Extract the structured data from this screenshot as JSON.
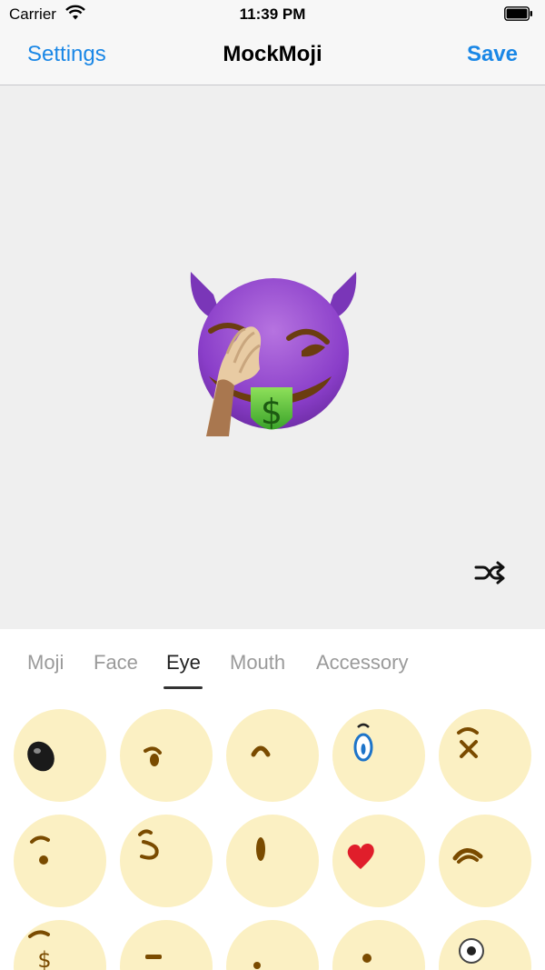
{
  "status_bar": {
    "carrier": "Carrier",
    "time": "11:39 PM"
  },
  "nav": {
    "left": "Settings",
    "title": "MockMoji",
    "right": "Save"
  },
  "preview": {
    "emoji_icon": "devil-facepalm-money-emoji-icon",
    "shuffle_icon": "shuffle-icon"
  },
  "tabs": [
    {
      "label": "Moji",
      "selected": false
    },
    {
      "label": "Face",
      "selected": false
    },
    {
      "label": "Eye",
      "selected": true
    },
    {
      "label": "Mouth",
      "selected": false
    },
    {
      "label": "Accessory",
      "selected": false
    }
  ],
  "eye_options": [
    "black-oval-eye-icon",
    "winking-eye-icon",
    "raised-brow-eye-icon",
    "blue-eye-icon",
    "x-eye-icon",
    "small-dot-eye-icon",
    "sideways-eye-icon",
    "vertical-oval-eye-icon",
    "heart-eye-icon",
    "squint-eye-icon",
    "dollar-eye-icon",
    "dash-eye-icon",
    "tiny-dot-eye-icon",
    "dot-eye-icon",
    "white-ring-eye-icon"
  ],
  "colors": {
    "accent": "#1a87e6",
    "preview_bg": "#efefef",
    "option_bg": "#fbf0c3",
    "eye_brown": "#7a4b00"
  }
}
